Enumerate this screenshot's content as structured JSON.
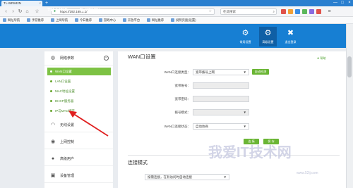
{
  "browser": {
    "tab_title": "TL-WR842N",
    "tab_close": "×",
    "new_tab": "+",
    "url": "https://192.168.1.1/",
    "search_placeholder": "在此搜索",
    "window_controls": [
      "—",
      "□",
      "×"
    ],
    "toolbar_icon_colors": [
      "#e0524a",
      "#f2a037",
      "#3a8ee6",
      "#5cb85c",
      "#8a6be0",
      "#e0524a"
    ],
    "bookmarks": [
      "网址导航",
      "手游推荐",
      "上网导航",
      "今日推荐",
      "游戏中心",
      "开放平台",
      "网址推荐",
      "说明页面(设置)"
    ]
  },
  "router": {
    "brand": "TP-LINK",
    "model": "TL-WR842N",
    "accent": "#177fd3",
    "nav": [
      {
        "label": "常用设置",
        "icon": "gear-icon"
      },
      {
        "label": "高级设置",
        "icon": "gears-icon"
      },
      {
        "label": "退出登录",
        "icon": "close-icon"
      }
    ]
  },
  "sidebar": {
    "groups": [
      {
        "label": "网络参数",
        "icon": "globe-icon",
        "expanded": true
      },
      {
        "label": "无线设置",
        "icon": "wifi-icon"
      },
      {
        "label": "上网控制",
        "icon": "shield-icon"
      },
      {
        "label": "高级用户",
        "icon": "user-icon"
      },
      {
        "label": "设备管理",
        "icon": "device-icon"
      }
    ],
    "subitems": [
      "WAN口设置",
      "LAN口设置",
      "MAC地址设置",
      "DHCP服务器",
      "IP与MAC绑定"
    ],
    "collapse_symbol": "−"
  },
  "main": {
    "title": "WAN口设置",
    "help": "帮助",
    "fields": [
      {
        "label": "WAN口连接类型：",
        "value": "宽带拨号上网",
        "type": "select"
      },
      {
        "label": "宽带账号：",
        "value": "",
        "type": "blurred"
      },
      {
        "label": "宽带密码：",
        "value": "",
        "type": "blurred"
      },
      {
        "label": "拨号模式：",
        "value": "",
        "type": "blurred-select"
      },
      {
        "label": "WAN口连接状态：",
        "value": "自动协商",
        "type": "select"
      }
    ],
    "auto_detect": "自动检测",
    "buttons": [
      "连 接",
      "保 存"
    ],
    "section2_title": "连接模式",
    "section2_value": "按需连接，在有访问时自动连接",
    "watermark": "我爱IT技术网",
    "watermark_url": "www.52ij.com",
    "caret": "▼"
  }
}
